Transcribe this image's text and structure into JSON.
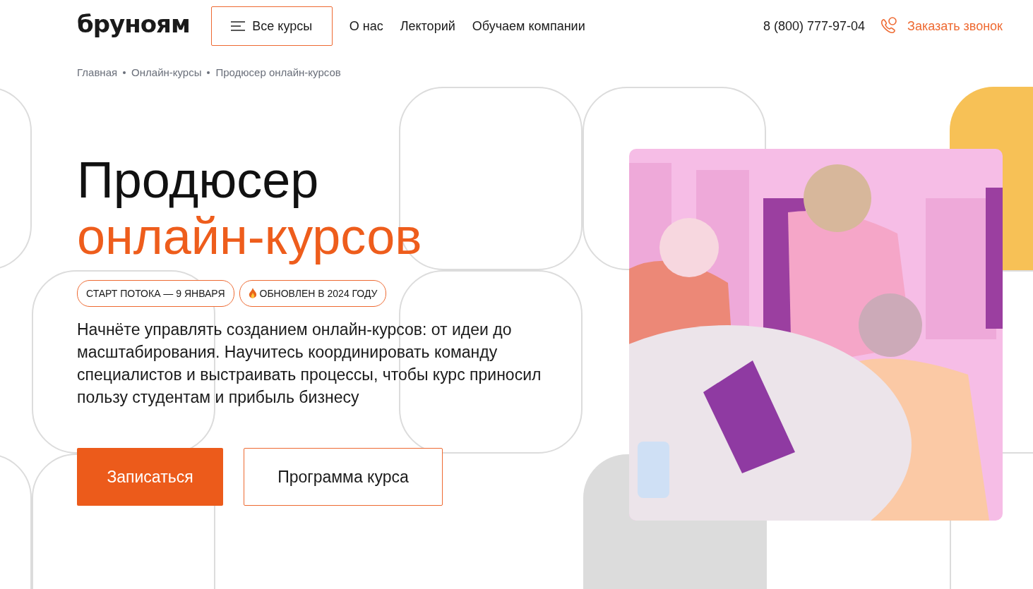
{
  "header": {
    "logo": "бруноям",
    "menu_button": "Все курсы",
    "nav": [
      "О нас",
      "Лекторий",
      "Обучаем компании"
    ],
    "phone": "8 (800) 777-97-04",
    "callback": "Заказать звонок"
  },
  "breadcrumbs": [
    "Главная",
    "Онлайн-курсы",
    "Продюсер онлайн-курсов"
  ],
  "hero": {
    "title": "Продюсер",
    "title_accent": "онлайн-курсов",
    "badges": [
      {
        "text": "СТАРТ ПОТОКА — 9 ЯНВАРЯ",
        "kind": "plain"
      },
      {
        "text": "ОБНОВЛЕН В 2024 ГОДУ",
        "kind": "fire"
      }
    ],
    "description": "Начнёте управлять созданием онлайн-курсов: от идеи до масштабирования. Научитесь координировать команду специалистов и выстраивать процессы, чтобы курс приносил пользу студентам и прибыль бизнесу",
    "buttons": [
      {
        "label": "Записаться",
        "kind": "primary"
      },
      {
        "label": "Программа курса",
        "kind": "outline"
      }
    ]
  }
}
